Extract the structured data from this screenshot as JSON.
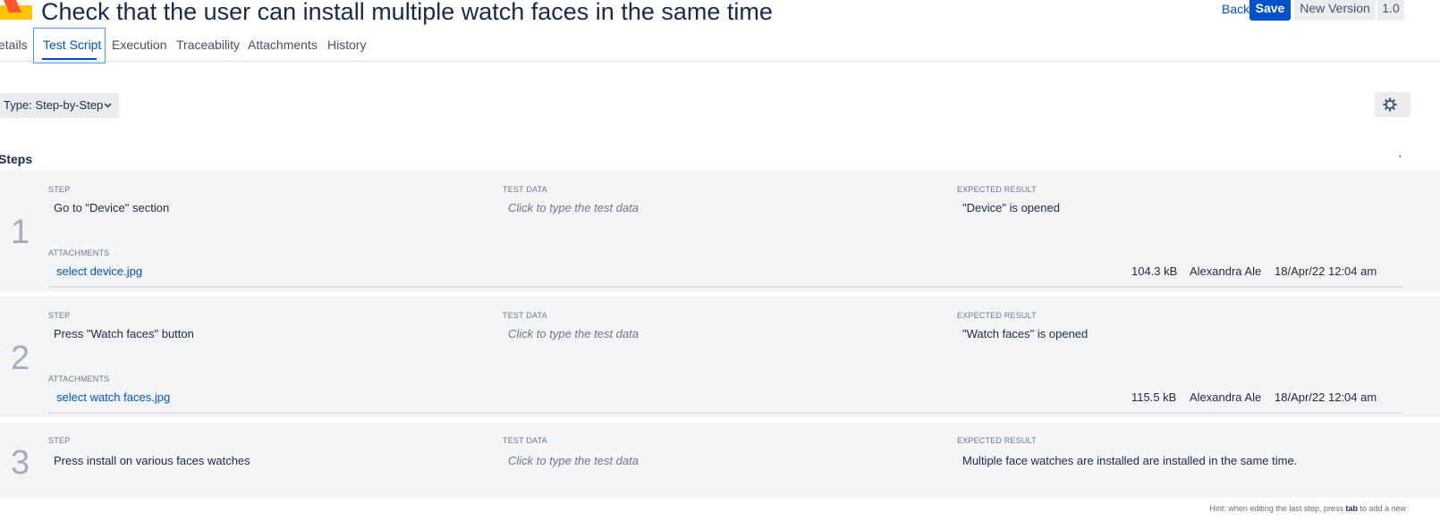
{
  "header": {
    "title": "Check that the user can install multiple watch faces in the same time",
    "back_label": "Back",
    "save_label": "Save",
    "new_version_label": "New Version",
    "version": "1.0"
  },
  "tabs": [
    {
      "label": "etails"
    },
    {
      "label": "Test Script",
      "active": true
    },
    {
      "label": "Execution"
    },
    {
      "label": "Traceability"
    },
    {
      "label": "Attachments"
    },
    {
      "label": "History"
    }
  ],
  "type_dropdown": {
    "label": "Type: Step-by-Step"
  },
  "steps_section": {
    "title": "Steps",
    "menu_glyph": "·",
    "labels": {
      "step": "STEP",
      "test_data": "TEST DATA",
      "expected": "EXPECTED RESULT",
      "attachments": "ATTACHMENTS"
    },
    "steps": [
      {
        "number": "1",
        "step": "Go to \"Device\" section",
        "test_data_placeholder": "Click to type the test data",
        "expected": "\"Device\" is opened",
        "attachment": {
          "name": "select device.jpg",
          "size": "104.3 kB",
          "user": "Alexandra Ale",
          "date": "18/Apr/22 12:04 am"
        }
      },
      {
        "number": "2",
        "step": "Press \"Watch faces\" button",
        "test_data_placeholder": "Click to type the test data",
        "expected": "\"Watch faces\" is opened",
        "attachment": {
          "name": "select watch faces.jpg",
          "size": "115.5 kB",
          "user": "Alexandra Ale",
          "date": "18/Apr/22 12:04 am"
        }
      },
      {
        "number": "3",
        "step": "Press install on various faces watches",
        "test_data_placeholder": "Click to type the test data",
        "expected": "Multiple face watches are installed are installed in the same time."
      }
    ]
  },
  "hint": {
    "before": "Hint: when editing the last step, press ",
    "key": "tab",
    "after": " to add a new"
  },
  "colors": {
    "primary": "#0052cc",
    "row_bg": "#f4f5f7",
    "button_bg": "#ebecf0",
    "text": "#172b4d"
  }
}
